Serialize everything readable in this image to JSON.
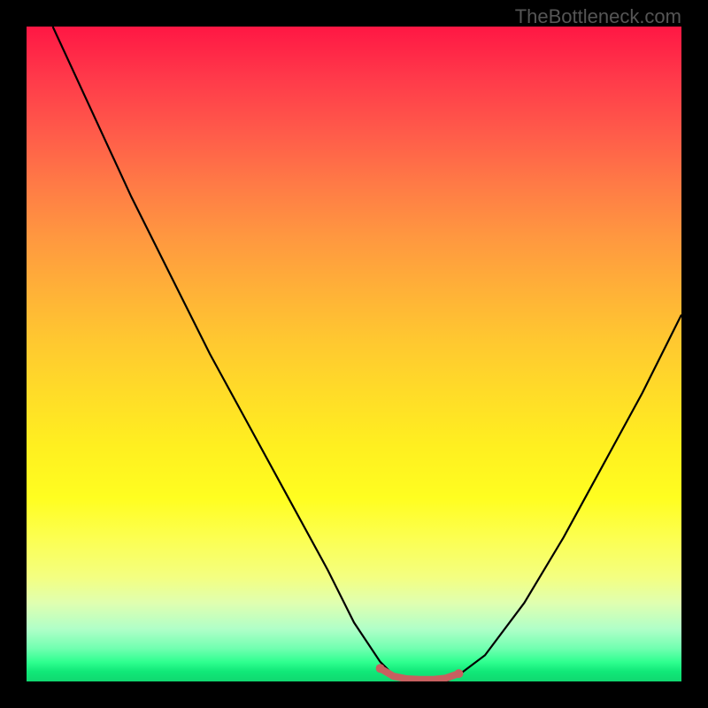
{
  "watermark": "TheBottleneck.com",
  "chart_data": {
    "type": "line",
    "title": "",
    "xlabel": "",
    "ylabel": "",
    "xlim": [
      0,
      100
    ],
    "ylim": [
      0,
      100
    ],
    "grid": false,
    "legend": false,
    "series": [
      {
        "name": "bottleneck-curve",
        "x": [
          4,
          10,
          16,
          22,
          28,
          34,
          40,
          46,
          50,
          54,
          56,
          58,
          60,
          62,
          64,
          66,
          70,
          76,
          82,
          88,
          94,
          100
        ],
        "y": [
          100,
          87,
          74,
          62,
          50,
          39,
          28,
          17,
          9,
          3,
          1,
          0,
          0,
          0,
          0,
          1,
          4,
          12,
          22,
          33,
          44,
          56
        ],
        "color": "#000000"
      },
      {
        "name": "sweet-spot-marker",
        "x": [
          54,
          56,
          58,
          60,
          62,
          64,
          66
        ],
        "y": [
          2.0,
          0.8,
          0.4,
          0.3,
          0.3,
          0.5,
          1.2
        ],
        "color": "#c86060"
      }
    ],
    "gradient_stops": [
      {
        "pos": 0,
        "color": "#ff1744"
      },
      {
        "pos": 50,
        "color": "#ffdc28"
      },
      {
        "pos": 85,
        "color": "#f4ff80"
      },
      {
        "pos": 100,
        "color": "#10d870"
      }
    ]
  }
}
